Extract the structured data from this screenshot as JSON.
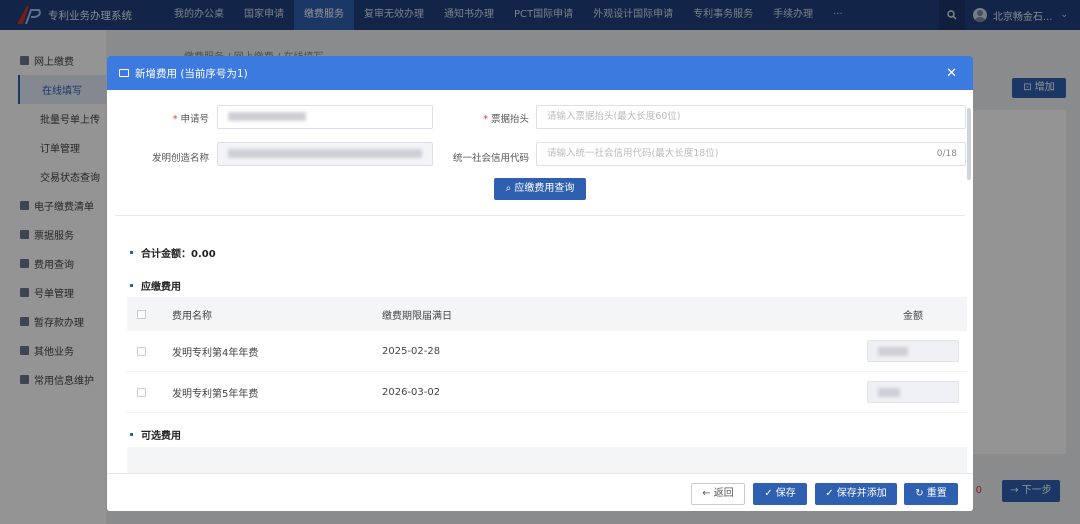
{
  "header": {
    "app_title": "专利业务办理系统",
    "nav": [
      "我的办公桌",
      "国家申请",
      "缴费服务",
      "复审无效办理",
      "通知书办理",
      "PCT国际申请",
      "外观设计国际申请",
      "专利事务服务",
      "手续办理",
      "···"
    ],
    "active_nav": "缴费服务",
    "user_name": "北京畅金石..."
  },
  "sidebar": {
    "items": [
      {
        "label": "网上缴费",
        "icon": "bank-icon"
      },
      {
        "label": "在线填写",
        "sub": true,
        "active": true
      },
      {
        "label": "批量号单上传",
        "sub": true
      },
      {
        "label": "订单管理",
        "sub": true
      },
      {
        "label": "交易状态查询",
        "sub": true
      },
      {
        "label": "电子缴费清单",
        "icon": "list-icon"
      },
      {
        "label": "票据服务",
        "icon": "receipt-icon"
      },
      {
        "label": "费用查询",
        "icon": "query-icon"
      },
      {
        "label": "号单管理",
        "icon": "doc-icon"
      },
      {
        "label": "暂存款办理",
        "icon": "deposit-icon"
      },
      {
        "label": "其他业务",
        "icon": "misc-icon"
      },
      {
        "label": "常用信息维护",
        "icon": "info-icon"
      }
    ]
  },
  "page": {
    "breadcrumb": "缴费服务 / 网上缴费 / 在线填写",
    "add_label": "增加",
    "next_label": "下一步",
    "zero_value": "0"
  },
  "modal": {
    "title": "新增费用 (当前序号为1)",
    "labels": {
      "app_no": "申请号",
      "bill_title": "票据抬头",
      "invention": "发明创造名称",
      "credit_code": "统一社会信用代码"
    },
    "placeholders": {
      "bill_title": "请输入票据抬头(最大长度60位)",
      "credit_code": "请输入统一社会信用代码(最大长度18位)"
    },
    "credit_counter": "0/18",
    "query_button": "应缴费用查询",
    "total_label": "合计金额：0.00",
    "due_section": "应缴费用",
    "optional_section": "可选费用",
    "columns": {
      "name": "费用名称",
      "deadline": "缴费期限届满日",
      "amount": "金额"
    },
    "due_rows": [
      {
        "name": "发明专利第4年年费",
        "date": "2025-02-28"
      },
      {
        "name": "发明专利第5年年费",
        "date": "2026-03-02"
      }
    ],
    "footer": {
      "back": "返回",
      "save": "保存",
      "save_add": "保存并添加",
      "reset": "重置"
    }
  },
  "colors": {
    "header": "#1f3f7a",
    "primary": "#2f5fb0",
    "modal_header": "#3d7ae0"
  }
}
